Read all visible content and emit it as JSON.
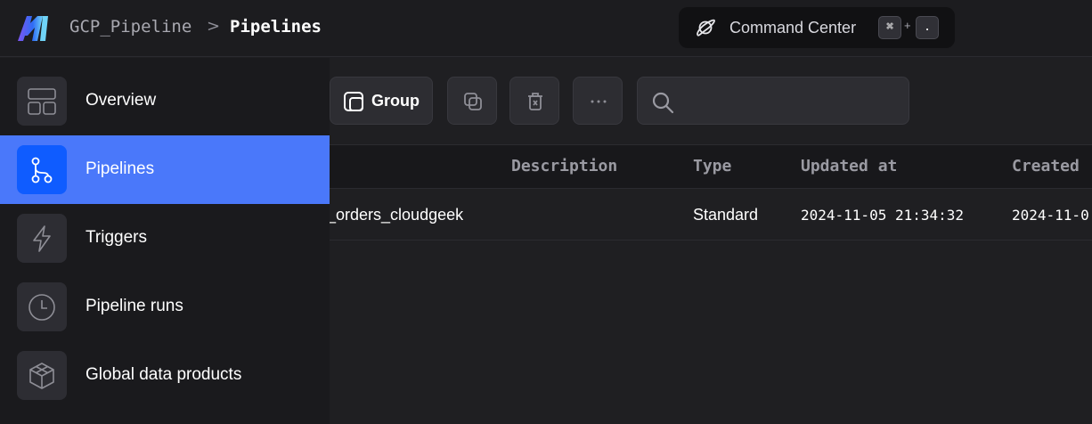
{
  "header": {
    "project": "GCP_Pipeline",
    "separator": ">",
    "current_page": "Pipelines",
    "command_center": {
      "label": "Command Center",
      "shortcut_key_1": "⌘",
      "shortcut_plus": "+",
      "shortcut_key_2": "."
    }
  },
  "toolbar": {
    "group_label": "Group",
    "more_label": "···",
    "search": {
      "value": "",
      "placeholder": ""
    }
  },
  "sidebar": {
    "items": [
      {
        "label": "Overview",
        "icon": "layout-icon",
        "active": false
      },
      {
        "label": "Pipelines",
        "icon": "pipeline-icon",
        "active": true
      },
      {
        "label": "Triggers",
        "icon": "lightning-icon",
        "active": false
      },
      {
        "label": "Pipeline runs",
        "icon": "clock-icon",
        "active": false
      },
      {
        "label": "Global data products",
        "icon": "cube-icon",
        "active": false
      }
    ]
  },
  "table": {
    "columns": [
      "e",
      "Description",
      "Type",
      "Updated at",
      "Created"
    ],
    "rows": [
      {
        "name": "_orders_cloudgeek",
        "description": "",
        "type": "Standard",
        "updated_at": "2024-11-05 21:34:32",
        "created_at": "2024-11-0"
      }
    ]
  },
  "colors": {
    "accent": "#4a78fa",
    "active_icon_bg": "#0f5cff",
    "background": "#1f1f22"
  }
}
